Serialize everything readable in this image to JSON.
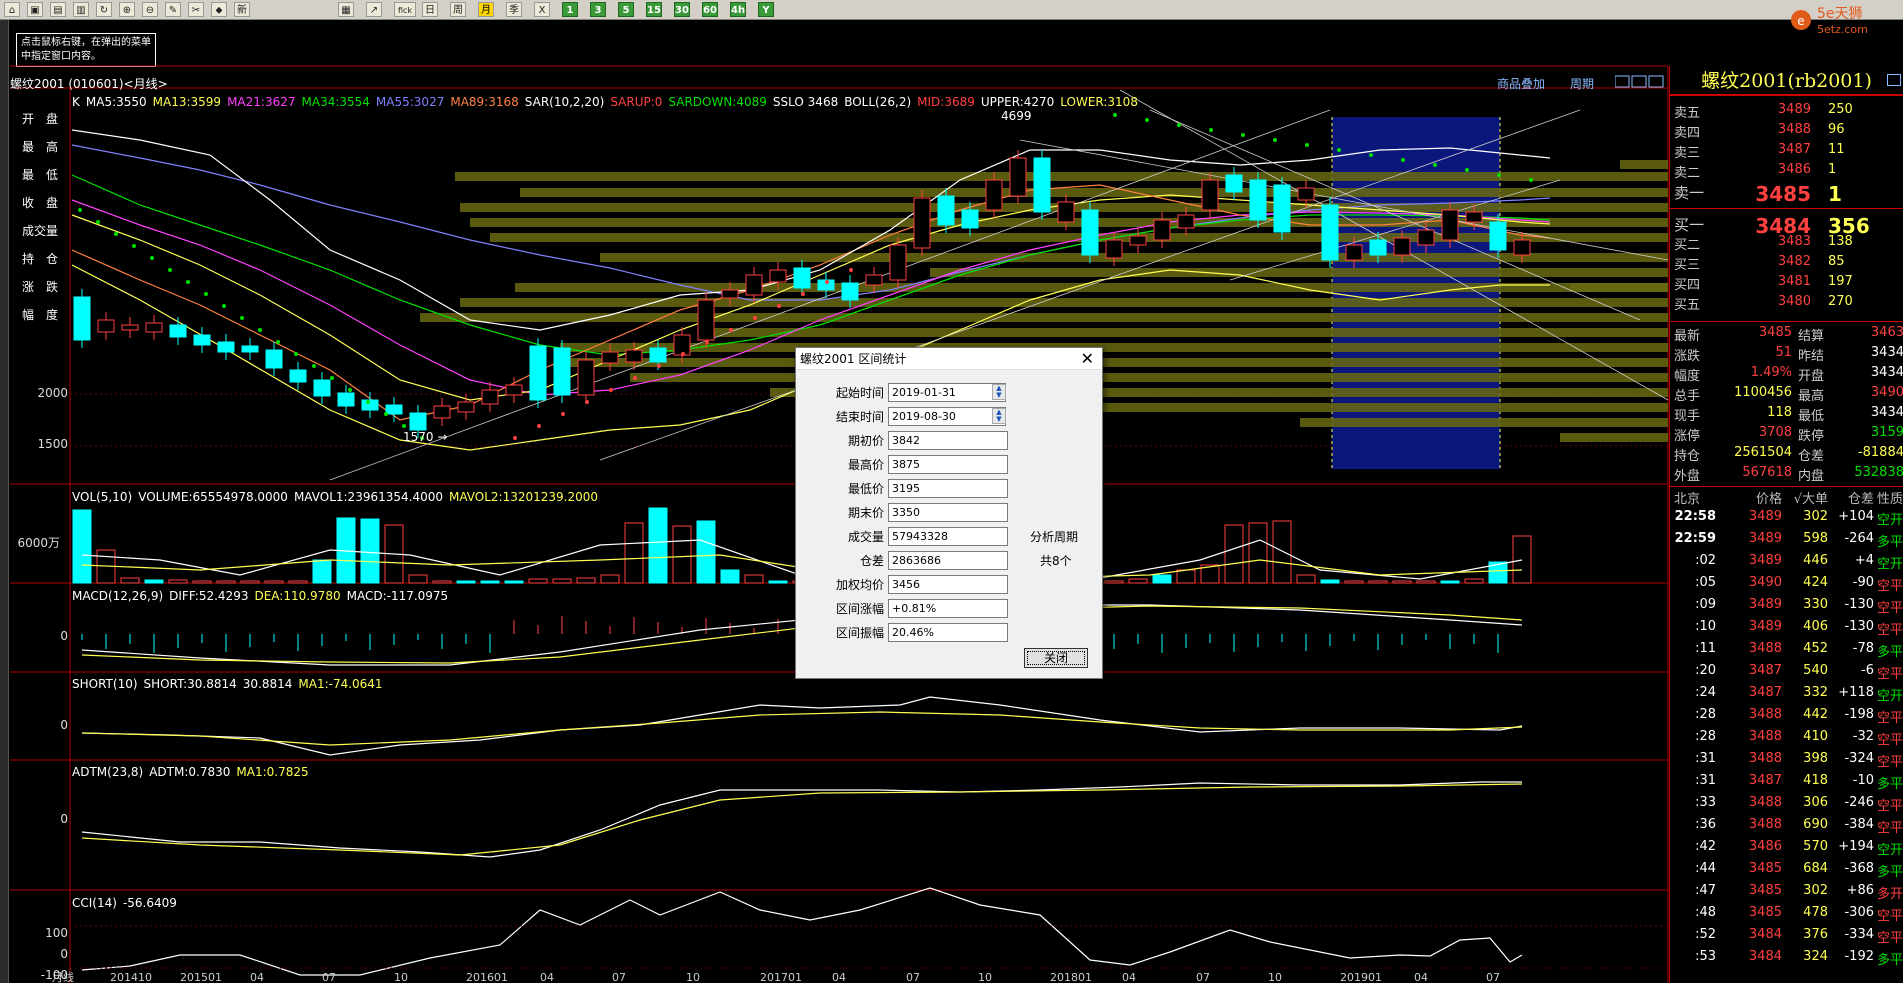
{
  "toolbar": {
    "buttons": [
      "⌂",
      "▣",
      "▤",
      "▥",
      "↻",
      "⊕",
      "⊖",
      "✎",
      "✂",
      "⬥",
      "新",
      "▦",
      "↗",
      "fick",
      "日",
      "周",
      "月",
      "季",
      "X",
      "1",
      "3",
      "5",
      "15",
      "30",
      "60",
      "4h",
      "Y"
    ]
  },
  "logo": {
    "text": "5e天狮",
    "sub": "5etz.com"
  },
  "tip": "点击鼠标右键，在弹出的菜单中指定窗口内容。",
  "chart_header": {
    "title": "螺纹2001 (010601)<月线>",
    "link1": "商品叠加",
    "link2": "周期"
  },
  "left_info": [
    "开　盘",
    "最　高",
    "最　低",
    "收　盘",
    "成交量",
    "持　仓",
    "涨　跌",
    "幅　度"
  ],
  "main_indicators": [
    {
      "text": "K",
      "color": "#ffffff"
    },
    {
      "text": "MA5:3550",
      "color": "#ffffff"
    },
    {
      "text": "MA13:3599",
      "color": "#ffff54"
    },
    {
      "text": "MA21:3627",
      "color": "#ff40ff"
    },
    {
      "text": "MA34:3554",
      "color": "#00e000"
    },
    {
      "text": "MA55:3027",
      "color": "#8080ff"
    },
    {
      "text": "MA89:3168",
      "color": "#ff8040"
    },
    {
      "text": "SAR(10,2,20)",
      "color": "#ffffff"
    },
    {
      "text": "SARUP:0",
      "color": "#ff4040"
    },
    {
      "text": "SARDOWN:4089",
      "color": "#00e000"
    },
    {
      "text": "SSLO 3468",
      "color": "#ffffff"
    },
    {
      "text": "BOLL(26,2)",
      "color": "#ffffff"
    },
    {
      "text": "MID:3689",
      "color": "#ff4040"
    },
    {
      "text": "UPPER:4270",
      "color": "#ffffff"
    },
    {
      "text": "LOWER:3108",
      "color": "#ffff54"
    }
  ],
  "price_axis": [
    "2000",
    "1500"
  ],
  "price_marks": {
    "high": "4699",
    "low": "1570"
  },
  "vol_panel": {
    "labels": [
      {
        "text": "VOL(5,10)",
        "color": "#ffffff"
      },
      {
        "text": "VOLUME:65554978.0000",
        "color": "#ffffff"
      },
      {
        "text": "MAVOL1:23961354.4000",
        "color": "#ffffff"
      },
      {
        "text": "MAVOL2:13201239.2000",
        "color": "#ffff54"
      }
    ],
    "axis": "6000万"
  },
  "macd_panel": {
    "labels": [
      {
        "text": "MACD(12,26,9)",
        "color": "#ffffff"
      },
      {
        "text": "DIFF:52.4293",
        "color": "#ffffff"
      },
      {
        "text": "DEA:110.9780",
        "color": "#ffff54"
      },
      {
        "text": "MACD:-117.0975",
        "color": "#ffffff"
      }
    ],
    "axis": "0"
  },
  "short_panel": {
    "labels": [
      {
        "text": "SHORT(10)",
        "color": "#ffffff"
      },
      {
        "text": "SHORT:30.8814",
        "color": "#ffffff"
      },
      {
        "text": "30.8814",
        "color": "#ffffff"
      },
      {
        "text": "MA1:-74.0641",
        "color": "#ffff54"
      }
    ],
    "axis": "0"
  },
  "adtm_panel": {
    "labels": [
      {
        "text": "ADTM(23,8)",
        "color": "#ffffff"
      },
      {
        "text": "ADTM:0.7830",
        "color": "#ffffff"
      },
      {
        "text": "MA1:0.7825",
        "color": "#ffff54"
      }
    ],
    "axis": "0"
  },
  "cci_panel": {
    "labels": [
      {
        "text": "CCI(14)",
        "color": "#ffffff"
      },
      {
        "text": "-56.6409",
        "color": "#ffffff"
      }
    ],
    "axis": [
      "100",
      "0",
      "-100"
    ]
  },
  "x_axis": [
    "月线",
    "201410",
    "201501",
    "04",
    "07",
    "10",
    "201601",
    "04",
    "07",
    "10",
    "201701",
    "04",
    "07",
    "10",
    "201801",
    "04",
    "07",
    "10",
    "201901",
    "04",
    "07"
  ],
  "dialog": {
    "title": "螺纹2001 区间统计",
    "close": "✕",
    "rows": [
      {
        "label": "起始时间",
        "value": "2019-01-31"
      },
      {
        "label": "结束时间",
        "value": "2019-08-30"
      },
      {
        "label": "期初价",
        "value": "3842"
      },
      {
        "label": "最高价",
        "value": "3875"
      },
      {
        "label": "最低价",
        "value": "3195"
      },
      {
        "label": "期末价",
        "value": "3350"
      },
      {
        "label": "成交量",
        "value": "57943328"
      },
      {
        "label": "仓差",
        "value": "2863686"
      },
      {
        "label": "加权均价",
        "value": "3456"
      },
      {
        "label": "区间涨幅",
        "value": "+0.81%"
      },
      {
        "label": "区间振幅",
        "value": "20.46%"
      }
    ],
    "side1": "分析周期",
    "side2": "共8个",
    "button": "关闭"
  },
  "right_panel": {
    "title": "螺纹2001(rb2001)",
    "asks": [
      {
        "label": "卖五",
        "price": "3489",
        "vol": "250"
      },
      {
        "label": "卖四",
        "price": "3488",
        "vol": "96"
      },
      {
        "label": "卖三",
        "price": "3487",
        "vol": "11"
      },
      {
        "label": "卖二",
        "price": "3486",
        "vol": "1"
      },
      {
        "label": "卖一",
        "price": "3485",
        "vol": "1"
      }
    ],
    "bids": [
      {
        "label": "买一",
        "price": "3484",
        "vol": "356"
      },
      {
        "label": "买二",
        "price": "3483",
        "vol": "138"
      },
      {
        "label": "买三",
        "price": "3482",
        "vol": "85"
      },
      {
        "label": "买四",
        "price": "3481",
        "vol": "197"
      },
      {
        "label": "买五",
        "price": "3480",
        "vol": "270"
      }
    ],
    "quotes": [
      {
        "l1": "最新",
        "v1": "3485",
        "c1": "red",
        "l2": "结算",
        "v2": "3463",
        "c2": "red"
      },
      {
        "l1": "涨跌",
        "v1": "51",
        "c1": "red",
        "l2": "昨结",
        "v2": "3434",
        "c2": "white"
      },
      {
        "l1": "幅度",
        "v1": "1.49%",
        "c1": "red",
        "l2": "开盘",
        "v2": "3434",
        "c2": "white"
      },
      {
        "l1": "总手",
        "v1": "1100456",
        "c1": "yellow",
        "l2": "最高",
        "v2": "3490",
        "c2": "red"
      },
      {
        "l1": "现手",
        "v1": "118",
        "c1": "yellow",
        "l2": "最低",
        "v2": "3434",
        "c2": "white"
      },
      {
        "l1": "涨停",
        "v1": "3708",
        "c1": "red",
        "l2": "跌停",
        "v2": "3159",
        "c2": "green"
      },
      {
        "l1": "持仓",
        "v1": "2561504",
        "c1": "yellow",
        "l2": "仓差",
        "v2": "-81884",
        "c2": "yellow"
      },
      {
        "l1": "外盘",
        "v1": "567618",
        "c1": "red",
        "l2": "内盘",
        "v2": "532838",
        "c2": "green"
      }
    ],
    "tick_header": [
      "北京",
      "价格",
      "√大单",
      "仓差",
      "性质"
    ],
    "ticks": [
      {
        "t": "22:58",
        "p": "3489",
        "v": "302",
        "c": "+104",
        "cc": "yellow",
        "n": "空开",
        "nc": "green"
      },
      {
        "t": "22:59",
        "p": "3489",
        "v": "598",
        "c": "-264",
        "cc": "yellow",
        "n": "多平",
        "nc": "green"
      },
      {
        "t": ":02",
        "p": "3489",
        "v": "446",
        "c": "+4",
        "cc": "yellow",
        "n": "空开",
        "nc": "green"
      },
      {
        "t": ":05",
        "p": "3490",
        "v": "424",
        "c": "-90",
        "cc": "yellow",
        "n": "空平",
        "nc": "red"
      },
      {
        "t": ":09",
        "p": "3489",
        "v": "330",
        "c": "-130",
        "cc": "yellow",
        "n": "空平",
        "nc": "red"
      },
      {
        "t": ":10",
        "p": "3489",
        "v": "406",
        "c": "-130",
        "cc": "yellow",
        "n": "空平",
        "nc": "red"
      },
      {
        "t": ":11",
        "p": "3488",
        "v": "452",
        "c": "-78",
        "cc": "yellow",
        "n": "多平",
        "nc": "green"
      },
      {
        "t": ":20",
        "p": "3487",
        "v": "540",
        "c": "-6",
        "cc": "yellow",
        "n": "空平",
        "nc": "red"
      },
      {
        "t": ":24",
        "p": "3487",
        "v": "332",
        "c": "+118",
        "cc": "yellow",
        "n": "空开",
        "nc": "green"
      },
      {
        "t": ":28",
        "p": "3488",
        "v": "442",
        "c": "-198",
        "cc": "yellow",
        "n": "空平",
        "nc": "red"
      },
      {
        "t": ":28",
        "p": "3488",
        "v": "410",
        "c": "-32",
        "cc": "yellow",
        "n": "空平",
        "nc": "red"
      },
      {
        "t": ":31",
        "p": "3488",
        "v": "398",
        "c": "-324",
        "cc": "yellow",
        "n": "空平",
        "nc": "red"
      },
      {
        "t": ":31",
        "p": "3487",
        "v": "418",
        "c": "-10",
        "cc": "yellow",
        "n": "多平",
        "nc": "green"
      },
      {
        "t": ":33",
        "p": "3488",
        "v": "306",
        "c": "-246",
        "cc": "yellow",
        "n": "空平",
        "nc": "red"
      },
      {
        "t": ":36",
        "p": "3488",
        "v": "690",
        "c": "-384",
        "cc": "yellow",
        "n": "空平",
        "nc": "red"
      },
      {
        "t": ":42",
        "p": "3486",
        "v": "570",
        "c": "+194",
        "cc": "yellow",
        "n": "空开",
        "nc": "green"
      },
      {
        "t": ":44",
        "p": "3485",
        "v": "684",
        "c": "-368",
        "cc": "yellow",
        "n": "多平",
        "nc": "green"
      },
      {
        "t": ":47",
        "p": "3485",
        "v": "302",
        "c": "+86",
        "cc": "yellow",
        "n": "多开",
        "nc": "red"
      },
      {
        "t": ":48",
        "p": "3485",
        "v": "478",
        "c": "-306",
        "cc": "yellow",
        "n": "空平",
        "nc": "red"
      },
      {
        "t": ":52",
        "p": "3484",
        "v": "376",
        "c": "-334",
        "cc": "yellow",
        "n": "空平",
        "nc": "red"
      },
      {
        "t": ":53",
        "p": "3484",
        "v": "324",
        "c": "-192",
        "cc": "yellow",
        "n": "多平",
        "nc": "green"
      }
    ]
  }
}
